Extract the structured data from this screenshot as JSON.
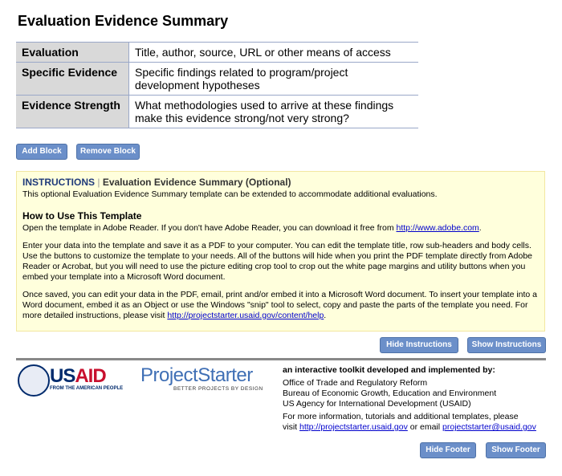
{
  "title": "Evaluation Evidence Summary",
  "table": [
    {
      "header": "Evaluation",
      "body": "Title, author, source, URL or other means of access"
    },
    {
      "header": "Specific Evidence",
      "body": "Specific findings related to program/project development hypotheses"
    },
    {
      "header": "Evidence Strength",
      "body": "What methodologies used to arrive at these findings make this evidence strong/not very strong?"
    }
  ],
  "buttons": {
    "add": "Add Block",
    "remove": "Remove Block",
    "hide_instructions": "Hide Instructions",
    "show_instructions": "Show Instructions",
    "hide_footer": "Hide Footer",
    "show_footer": "Show Footer"
  },
  "instructions": {
    "label": "INSTRUCTIONS",
    "sep": "|",
    "title": "Evaluation Evidence Summary (Optional)",
    "intro": "This optional Evaluation Evidence Summary template can be extended to accommodate additional evaluations.",
    "howto_heading": "How to Use This Template",
    "p1": "Open the template in Adobe Reader. If you don't have Adobe Reader, you can download it free from ",
    "p1_link": "http://www.adobe.com",
    "p1_end": ".",
    "p2": "Enter your data into the template and save it as a PDF to your computer. You can edit the template title, row sub-headers and body cells. Use the buttons to customize the template to your needs. All of the buttons will hide when you print the PDF template directly from Adobe Reader or Acrobat, but you will need to use the picture editing crop tool to crop out the white page margins and utility buttons when you embed your template into a Microsoft Word document.",
    "p3": "Once saved, you can edit your data in the PDF, email, print and/or embed it into a Microsoft Word document. To insert your template into a Word document, embed it as an Object or use the Windows \"snip\" tool to select, copy and paste the parts of the template you need. For more detailed instructions, please visit ",
    "p3_link": "http://projectstarter.usaid.gov/content/help",
    "p3_end": "."
  },
  "footer": {
    "usaid_logo": "USAID",
    "usaid_tag": "FROM THE AMERICAN PEOPLE",
    "ps_logo": "ProjectStarter",
    "ps_tag": "BETTER PROJECTS BY DESIGN",
    "heading": "an interactive toolkit developed and implemented by:",
    "line1": "Office of Trade and Regulatory Reform",
    "line2": "Bureau of Economic Growth, Education and Environment",
    "line3": "US Agency for International Development (USAID)",
    "more": "For more information, tutorials and additional templates, please",
    "visit": "visit ",
    "link1": "http://projectstarter.usaid.gov",
    "or": " or email ",
    "link2": "projectstarter@usaid.gov"
  },
  "colors": {
    "button": "#6b8fc9",
    "instructions_bg": "#ffffdc",
    "instructions_label": "#1f3a7a",
    "usaid_red": "#c8102e",
    "usaid_blue": "#002a6c",
    "ps_blue": "#3f6fb5"
  }
}
